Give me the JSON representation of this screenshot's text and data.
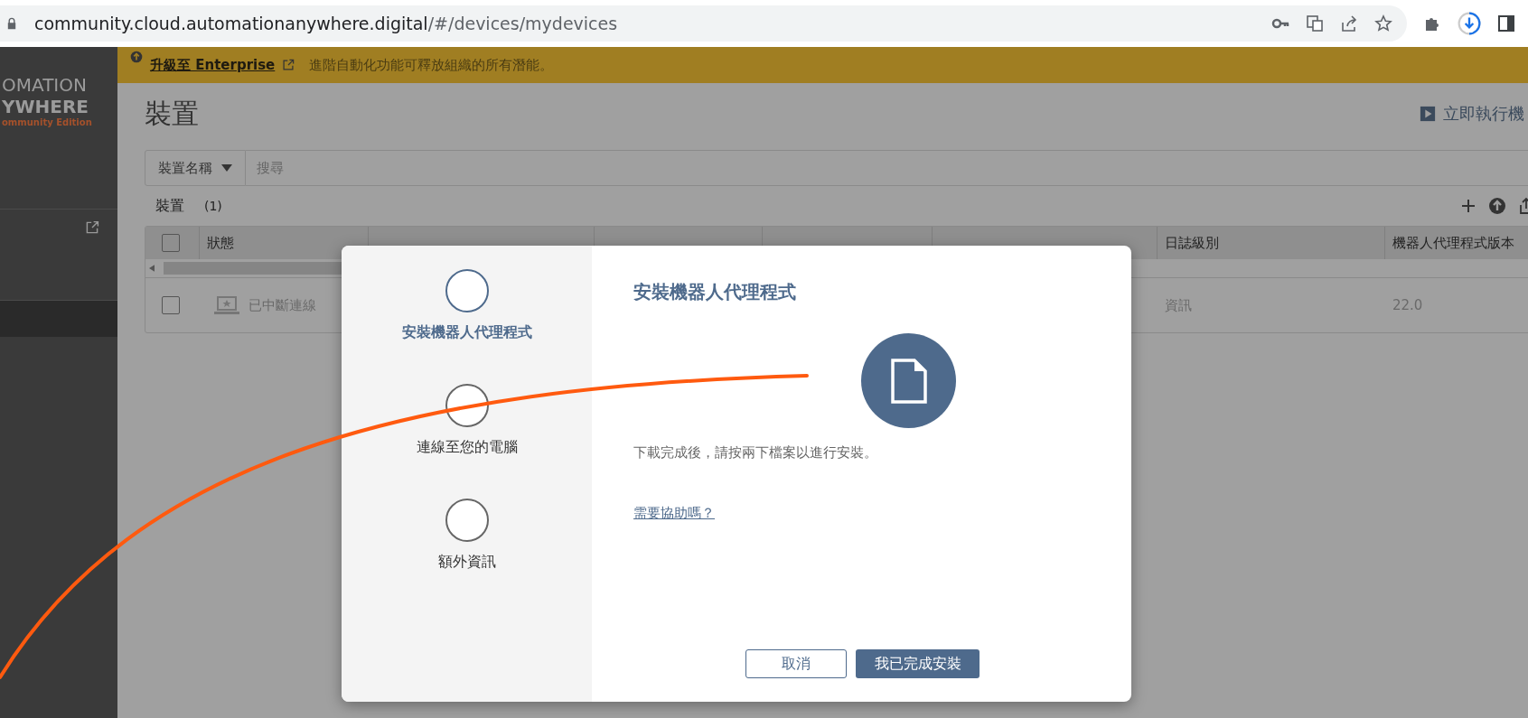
{
  "browser": {
    "url_host": "community.cloud.automationanywhere.digital",
    "url_path": "/#/devices/mydevices"
  },
  "sidebar": {
    "logo_lines": [
      "OMATION",
      "YWHERE"
    ],
    "edition": "ommunity Edition",
    "items": [
      {
        "kind": "external",
        "selected": false
      },
      {
        "kind": "plain",
        "selected": true
      }
    ]
  },
  "banner": {
    "link": "升級至 Enterprise",
    "text": "進階自動化功能可釋放組織的所有潛能。"
  },
  "page": {
    "title": "裝置",
    "run_button": "立即執行機"
  },
  "filter": {
    "field": "裝置名稱",
    "placeholder": "搜尋"
  },
  "list": {
    "title": "裝置",
    "count": "(1)"
  },
  "table": {
    "header_checked": false,
    "columns": [
      {
        "label": "狀態"
      },
      {
        "label": "日誌級別"
      },
      {
        "label": "機器人代理程式版本"
      }
    ],
    "rows": [
      {
        "checked": false,
        "status": "已中斷連線",
        "log_level": "資訊",
        "version": "22.0"
      }
    ]
  },
  "modal": {
    "steps": [
      {
        "label": "安裝機器人代理程式",
        "selected": true
      },
      {
        "label": "連線至您的電腦",
        "selected": false
      },
      {
        "label": "額外資訊",
        "selected": false
      }
    ],
    "title": "安裝機器人代理程式",
    "message": "下載完成後，請按兩下檔案以進行安裝。",
    "help_link": "需要協助嗎？",
    "cancel": "取消",
    "confirm": "我已完成安裝"
  }
}
